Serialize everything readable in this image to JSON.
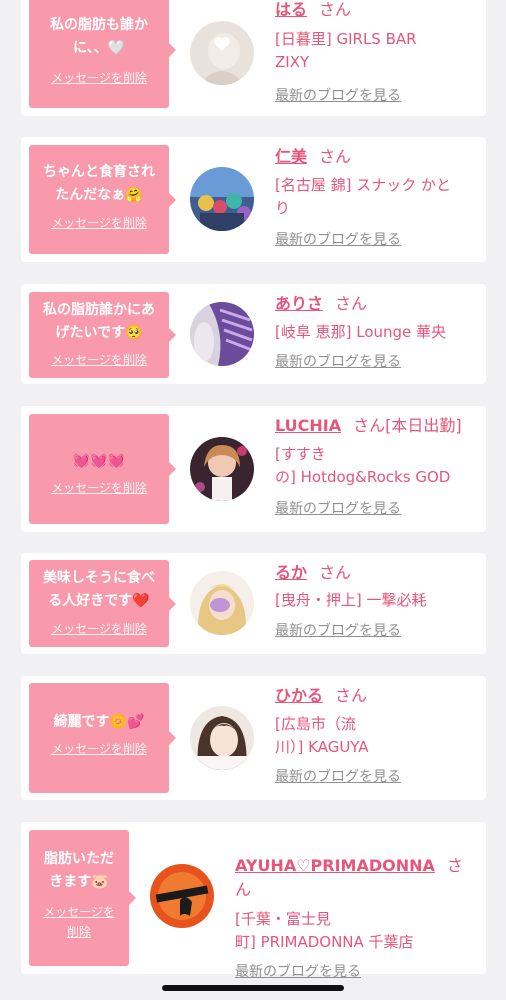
{
  "delete_label": "メッセージを削除",
  "blog_label": "最新のブログを見る",
  "san_label": "さん",
  "cards": [
    {
      "message": "私の脂肪も誰か\nに、、🤍",
      "name": "はる",
      "san": "さん",
      "shop": "[日暮里] GIRLS BAR\nZIXY"
    },
    {
      "message": "ちゃんと食育され\nたんだなぁ🤗",
      "name": "仁美",
      "san": "さん",
      "shop": "[名古屋 錦] スナック かと\nり"
    },
    {
      "message": "私の脂肪誰かにあ\nげたいです🥺",
      "name": "ありさ",
      "san": "さん",
      "shop": "[岐阜 恵那] Lounge 華央"
    },
    {
      "message": "💓💓💓",
      "name": "LUCHIA",
      "san": "さん[本日出勤]",
      "shop": "[すすき\nの] Hotdog&Rocks GOD"
    },
    {
      "message": "美味しそうに食べ\nる人好きです❤️",
      "name": "るか",
      "san": "さん",
      "shop": "[曳舟・押上] 一撃必耗"
    },
    {
      "message": "綺麗です🌼💕",
      "name": "ひかる",
      "san": "さん",
      "shop": "[広島市（流\n川）] KAGUYA"
    },
    {
      "message": "脂肪いただ\nきます🐷",
      "name": "AYUHA♡PRIMADONNA",
      "san": "さ\nん",
      "shop": "[千葉・富士見\n町] PRIMADONNA 千葉店",
      "delete": "メッセージを\n削除"
    }
  ],
  "colors": {
    "bubble": "#f89aab",
    "accent": "#e8557a",
    "muted": "#909090",
    "background": "#f1f1f3"
  }
}
